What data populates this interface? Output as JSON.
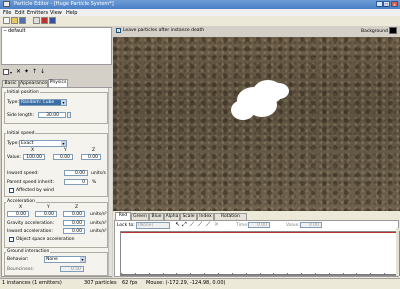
{
  "window": {
    "title": "Particle Editor - [Huge Particle System*]",
    "controls": [
      "_",
      "□",
      "x"
    ]
  },
  "menu": [
    "File",
    "Edit",
    "Emitters",
    "View",
    "Help"
  ],
  "tree": {
    "root": "default"
  },
  "tabs": [
    "Basic",
    "Appearance",
    "Physics"
  ],
  "leave_particles_label": "Leave particles after instance death",
  "background_label": "Background",
  "initial_position": {
    "title": "Initial position",
    "type_label": "Type:",
    "type_value": "Random: Cube",
    "side_label": "Side length:",
    "side_value": "30.00"
  },
  "initial_speed": {
    "title": "Initial speed",
    "type_label": "Type:",
    "type_value": "Exact",
    "axes": [
      "X",
      "Y",
      "Z"
    ],
    "value_label": "Value:",
    "values": [
      "100.00",
      "0.00",
      "0.00"
    ],
    "inward_label": "Inward speed:",
    "inward_value": "0.00",
    "inward_unit": "units/s",
    "inherit_label": "Parent speed inherit:",
    "inherit_value": "0",
    "inherit_unit": "%",
    "wind_label": "Affected by wind"
  },
  "acceleration": {
    "title": "Acceleration",
    "axes": [
      "X",
      "Y",
      "Z"
    ],
    "values": [
      "0.00",
      "0.00",
      "0.00"
    ],
    "unit": "units/s²",
    "gravity_label": "Gravity acceleration:",
    "gravity_value": "0.00",
    "inward_label": "Inward acceleration:",
    "inward_value": "0.00",
    "object_space_label": "Object space acceleration"
  },
  "ground": {
    "title": "Ground interaction",
    "behavior_label": "Behavior:",
    "behavior_value": "None",
    "bounciness_label": "Bounciness:",
    "bounciness_value": "0.50"
  },
  "graph": {
    "tabs": [
      "Red",
      "Green",
      "Blue",
      "Alpha",
      "Scale",
      "Index",
      "Rotation speed"
    ],
    "lock_label": "Lock to:",
    "lock_value": "(None)",
    "time_label": "Time:",
    "time_value": "0.00",
    "value_label": "Value:",
    "value_value": "0.00"
  },
  "status": {
    "instances": "1 instances (1 emitters)",
    "particles": "307 particles",
    "fps": "62 fps",
    "mouse": "Mouse: (-172.29, -124.98, 0.00)"
  },
  "colors": {
    "accent": "#4a7fc6",
    "ground": "#5c513f",
    "particles": "#ffffff"
  }
}
